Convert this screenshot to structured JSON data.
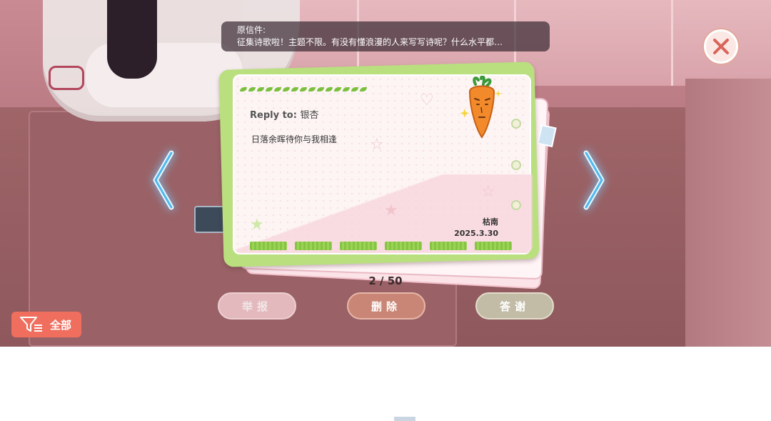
{
  "original_letter": {
    "label": "原信件:",
    "text": "征集诗歌啦！主题不限。有没有懂浪漫的人来写写诗呢？什么水平都…"
  },
  "letter": {
    "reply_prefix": "Reply to:",
    "reply_name": "银杏",
    "body": "日落余晖待你与我相逢",
    "signer": "枯南",
    "date": "2025.3.30"
  },
  "pager": {
    "current": "2",
    "separator": "/",
    "total": "50"
  },
  "buttons": {
    "report": "举报",
    "delete": "删除",
    "thanks": "答谢"
  },
  "filter": {
    "label": "全部"
  },
  "icons": [
    "close-icon",
    "left-arrow-icon",
    "right-arrow-icon",
    "filter-icon",
    "carrot-sticker-icon"
  ],
  "colors": {
    "accent": "#ef6e5e",
    "card_green": "#b9df7f",
    "arrow_glow": "#7ad0ff"
  }
}
